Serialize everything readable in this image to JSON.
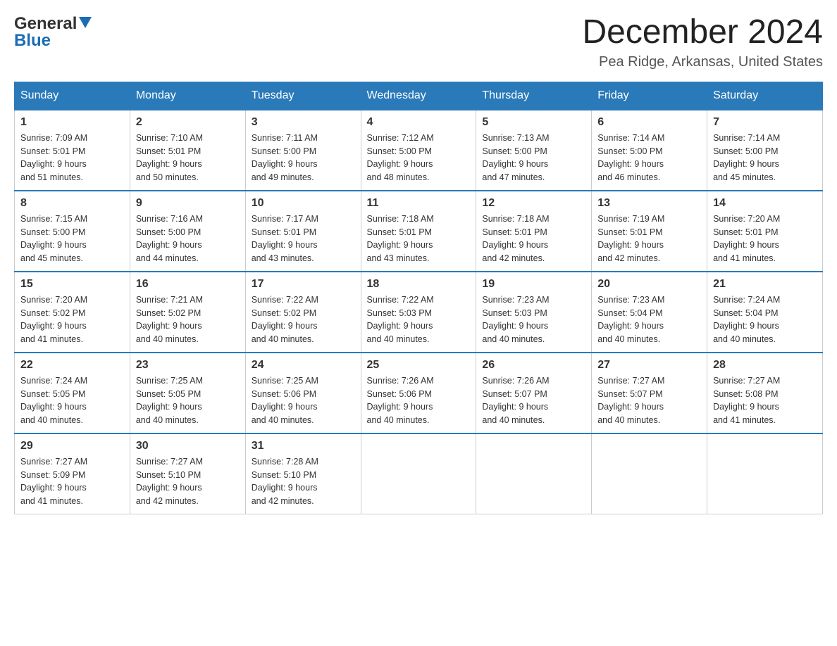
{
  "header": {
    "logo_general": "General",
    "logo_blue": "Blue",
    "title": "December 2024",
    "location": "Pea Ridge, Arkansas, United States"
  },
  "days_of_week": [
    "Sunday",
    "Monday",
    "Tuesday",
    "Wednesday",
    "Thursday",
    "Friday",
    "Saturday"
  ],
  "weeks": [
    [
      {
        "day": "1",
        "sunrise": "7:09 AM",
        "sunset": "5:01 PM",
        "daylight": "9 hours and 51 minutes."
      },
      {
        "day": "2",
        "sunrise": "7:10 AM",
        "sunset": "5:01 PM",
        "daylight": "9 hours and 50 minutes."
      },
      {
        "day": "3",
        "sunrise": "7:11 AM",
        "sunset": "5:00 PM",
        "daylight": "9 hours and 49 minutes."
      },
      {
        "day": "4",
        "sunrise": "7:12 AM",
        "sunset": "5:00 PM",
        "daylight": "9 hours and 48 minutes."
      },
      {
        "day": "5",
        "sunrise": "7:13 AM",
        "sunset": "5:00 PM",
        "daylight": "9 hours and 47 minutes."
      },
      {
        "day": "6",
        "sunrise": "7:14 AM",
        "sunset": "5:00 PM",
        "daylight": "9 hours and 46 minutes."
      },
      {
        "day": "7",
        "sunrise": "7:14 AM",
        "sunset": "5:00 PM",
        "daylight": "9 hours and 45 minutes."
      }
    ],
    [
      {
        "day": "8",
        "sunrise": "7:15 AM",
        "sunset": "5:00 PM",
        "daylight": "9 hours and 45 minutes."
      },
      {
        "day": "9",
        "sunrise": "7:16 AM",
        "sunset": "5:00 PM",
        "daylight": "9 hours and 44 minutes."
      },
      {
        "day": "10",
        "sunrise": "7:17 AM",
        "sunset": "5:01 PM",
        "daylight": "9 hours and 43 minutes."
      },
      {
        "day": "11",
        "sunrise": "7:18 AM",
        "sunset": "5:01 PM",
        "daylight": "9 hours and 43 minutes."
      },
      {
        "day": "12",
        "sunrise": "7:18 AM",
        "sunset": "5:01 PM",
        "daylight": "9 hours and 42 minutes."
      },
      {
        "day": "13",
        "sunrise": "7:19 AM",
        "sunset": "5:01 PM",
        "daylight": "9 hours and 42 minutes."
      },
      {
        "day": "14",
        "sunrise": "7:20 AM",
        "sunset": "5:01 PM",
        "daylight": "9 hours and 41 minutes."
      }
    ],
    [
      {
        "day": "15",
        "sunrise": "7:20 AM",
        "sunset": "5:02 PM",
        "daylight": "9 hours and 41 minutes."
      },
      {
        "day": "16",
        "sunrise": "7:21 AM",
        "sunset": "5:02 PM",
        "daylight": "9 hours and 40 minutes."
      },
      {
        "day": "17",
        "sunrise": "7:22 AM",
        "sunset": "5:02 PM",
        "daylight": "9 hours and 40 minutes."
      },
      {
        "day": "18",
        "sunrise": "7:22 AM",
        "sunset": "5:03 PM",
        "daylight": "9 hours and 40 minutes."
      },
      {
        "day": "19",
        "sunrise": "7:23 AM",
        "sunset": "5:03 PM",
        "daylight": "9 hours and 40 minutes."
      },
      {
        "day": "20",
        "sunrise": "7:23 AM",
        "sunset": "5:04 PM",
        "daylight": "9 hours and 40 minutes."
      },
      {
        "day": "21",
        "sunrise": "7:24 AM",
        "sunset": "5:04 PM",
        "daylight": "9 hours and 40 minutes."
      }
    ],
    [
      {
        "day": "22",
        "sunrise": "7:24 AM",
        "sunset": "5:05 PM",
        "daylight": "9 hours and 40 minutes."
      },
      {
        "day": "23",
        "sunrise": "7:25 AM",
        "sunset": "5:05 PM",
        "daylight": "9 hours and 40 minutes."
      },
      {
        "day": "24",
        "sunrise": "7:25 AM",
        "sunset": "5:06 PM",
        "daylight": "9 hours and 40 minutes."
      },
      {
        "day": "25",
        "sunrise": "7:26 AM",
        "sunset": "5:06 PM",
        "daylight": "9 hours and 40 minutes."
      },
      {
        "day": "26",
        "sunrise": "7:26 AM",
        "sunset": "5:07 PM",
        "daylight": "9 hours and 40 minutes."
      },
      {
        "day": "27",
        "sunrise": "7:27 AM",
        "sunset": "5:07 PM",
        "daylight": "9 hours and 40 minutes."
      },
      {
        "day": "28",
        "sunrise": "7:27 AM",
        "sunset": "5:08 PM",
        "daylight": "9 hours and 41 minutes."
      }
    ],
    [
      {
        "day": "29",
        "sunrise": "7:27 AM",
        "sunset": "5:09 PM",
        "daylight": "9 hours and 41 minutes."
      },
      {
        "day": "30",
        "sunrise": "7:27 AM",
        "sunset": "5:10 PM",
        "daylight": "9 hours and 42 minutes."
      },
      {
        "day": "31",
        "sunrise": "7:28 AM",
        "sunset": "5:10 PM",
        "daylight": "9 hours and 42 minutes."
      },
      null,
      null,
      null,
      null
    ]
  ],
  "labels": {
    "sunrise": "Sunrise:",
    "sunset": "Sunset:",
    "daylight": "Daylight:"
  }
}
